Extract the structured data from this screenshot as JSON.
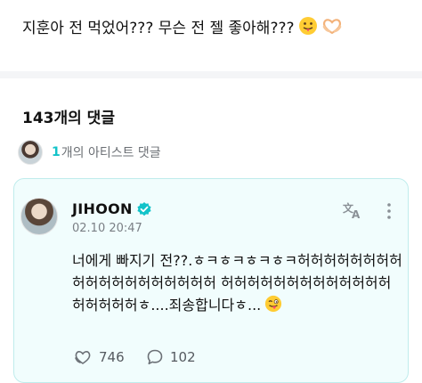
{
  "post": {
    "text": "지훈아 전 먹었어??? 무슨 전 젤 좋아해???"
  },
  "comments": {
    "title": "143개의 댓글",
    "artist_count": "1",
    "artist_label": "개의 아티스트 댓글"
  },
  "comment": {
    "author": "JIHOON",
    "date": "02.10 20:47",
    "body": "너에게 빠지기 전??.ㅎㅋㅎㅋㅎㅋㅎㅋ허허허허허허허허허허허허허허허허허허허 허허허허허허허허허허허허허허허허허허ㅎ....죄송합니다ㅎ...",
    "likes": "746",
    "replies": "102"
  },
  "icons": {
    "verified": "verified-badge-icon",
    "translate": "translate-icon",
    "more": "more-vertical-icon",
    "like": "heart-hands-icon",
    "reply": "comment-bubble-icon"
  },
  "colors": {
    "accent": "#12c3c9",
    "card_bg": "#f1fdfd",
    "card_border": "#bfecec"
  }
}
